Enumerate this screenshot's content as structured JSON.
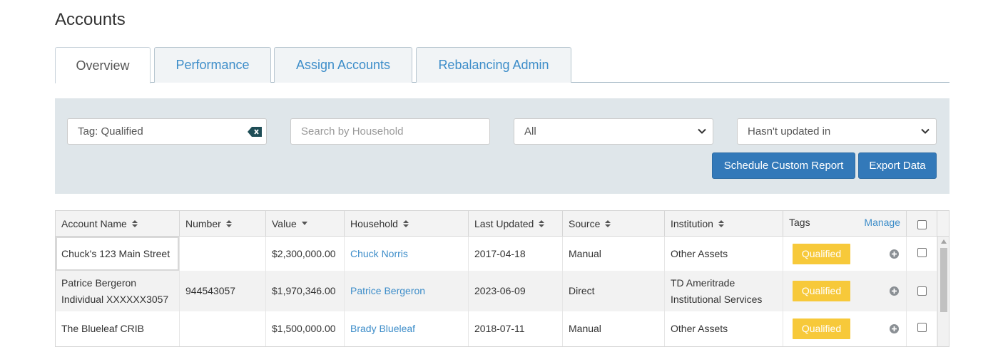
{
  "page": {
    "title": "Accounts"
  },
  "tabs": [
    {
      "label": "Overview",
      "active": true
    },
    {
      "label": "Performance",
      "active": false
    },
    {
      "label": "Assign Accounts",
      "active": false
    },
    {
      "label": "Rebalancing Admin",
      "active": false
    }
  ],
  "filters": {
    "tag_value": "Tag: Qualified",
    "household_placeholder": "Search by Household",
    "source_select": "All",
    "update_select": "Hasn't updated in",
    "schedule_button": "Schedule Custom Report",
    "export_button": "Export Data"
  },
  "table": {
    "headers": {
      "account_name": "Account Name",
      "number": "Number",
      "value": "Value",
      "household": "Household",
      "last_updated": "Last Updated",
      "source": "Source",
      "institution": "Institution",
      "tags": "Tags",
      "manage": "Manage"
    },
    "rows": [
      {
        "account_name": "Chuck's 123 Main Street",
        "number": "",
        "value": "$2,300,000.00",
        "household": "Chuck Norris",
        "last_updated": "2017-04-18",
        "source": "Manual",
        "institution": "Other Assets",
        "tag": "Qualified"
      },
      {
        "account_name": "Patrice Bergeron Individual XXXXXX3057",
        "number": "944543057",
        "value": "$1,970,346.00",
        "household": "Patrice Bergeron",
        "last_updated": "2023-06-09",
        "source": "Direct",
        "institution": "TD Ameritrade Institutional Services",
        "tag": "Qualified"
      },
      {
        "account_name": "The Blueleaf CRIB",
        "number": "",
        "value": "$1,500,000.00",
        "household": "Brady Blueleaf",
        "last_updated": "2018-07-11",
        "source": "Manual",
        "institution": "Other Assets",
        "tag": "Qualified"
      }
    ]
  },
  "colors": {
    "accent": "#3d8dc9",
    "button": "#3379b9",
    "tag": "#f7c93a",
    "panel": "#dfe6ea"
  },
  "icons": {
    "clear": "backspace-icon",
    "sort": "sort-icon",
    "sort_desc": "sort-down-icon",
    "add_tag": "plus-circle-icon",
    "select": "chevron-down-icon"
  }
}
